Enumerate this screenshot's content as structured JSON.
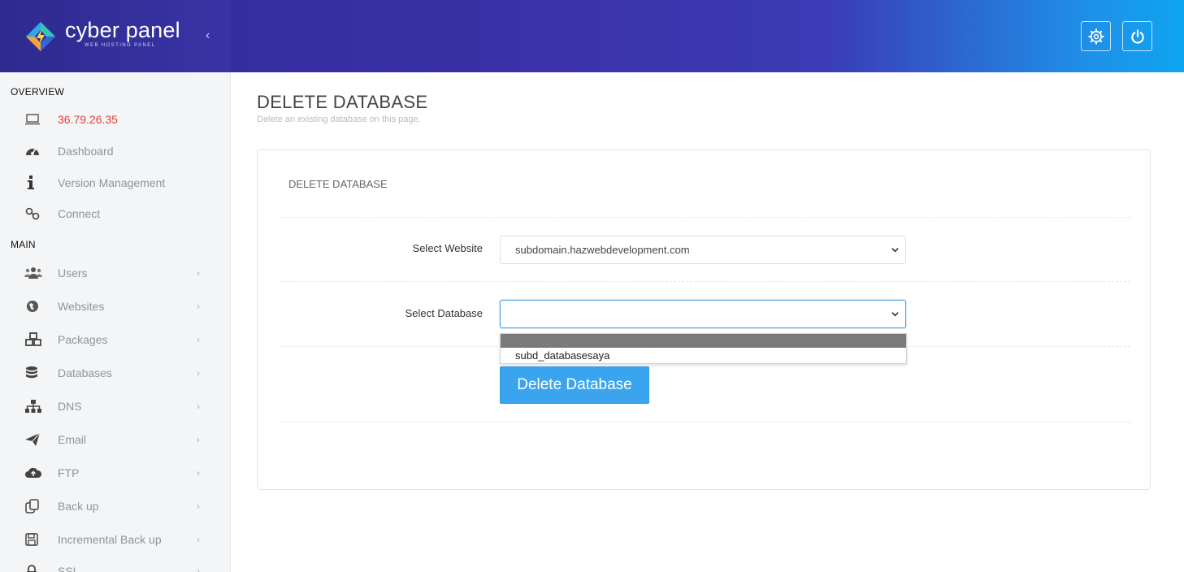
{
  "brand": {
    "name": "cyber panel",
    "tagline": "WEB HOSTING PANEL",
    "collapse_icon": "chevron-left-icon"
  },
  "header": {
    "buttons": [
      {
        "icon": "gear-icon"
      },
      {
        "icon": "power-icon"
      }
    ]
  },
  "sidebar": {
    "overview_title": "OVERVIEW",
    "overview_items": [
      {
        "label": "36.79.26.35",
        "icon": "laptop-icon"
      },
      {
        "label": "Dashboard",
        "icon": "dashboard-icon"
      },
      {
        "label": "Version Management",
        "icon": "info-icon"
      },
      {
        "label": "Connect",
        "icon": "link-icon"
      }
    ],
    "main_title": "MAIN",
    "main_items": [
      {
        "label": "Users",
        "icon": "users-icon"
      },
      {
        "label": "Websites",
        "icon": "globe-icon"
      },
      {
        "label": "Packages",
        "icon": "cubes-icon"
      },
      {
        "label": "Databases",
        "icon": "database-icon"
      },
      {
        "label": "DNS",
        "icon": "sitemap-icon"
      },
      {
        "label": "Email",
        "icon": "paper-plane-icon"
      },
      {
        "label": "FTP",
        "icon": "cloud-upload-icon"
      },
      {
        "label": "Back up",
        "icon": "copy-icon"
      },
      {
        "label": "Incremental Back up",
        "icon": "save-icon"
      },
      {
        "label": "SSL",
        "icon": "lock-icon"
      }
    ],
    "chevron": "›"
  },
  "page": {
    "title": "DELETE DATABASE",
    "subtitle": "Delete an existing database on this page.",
    "panel_title": "DELETE DATABASE",
    "website_label": "Select Website",
    "website_value": "subdomain.hazwebdevelopment.com",
    "database_label": "Select Database",
    "database_value": "",
    "database_options": [
      "",
      "subd_databasesaya"
    ],
    "delete_button": "Delete Database"
  },
  "colors": {
    "accent": "#3aa5ee",
    "header_start": "#2f2a99",
    "header_end": "#0ea5f0",
    "ip_text": "#e2413a"
  }
}
